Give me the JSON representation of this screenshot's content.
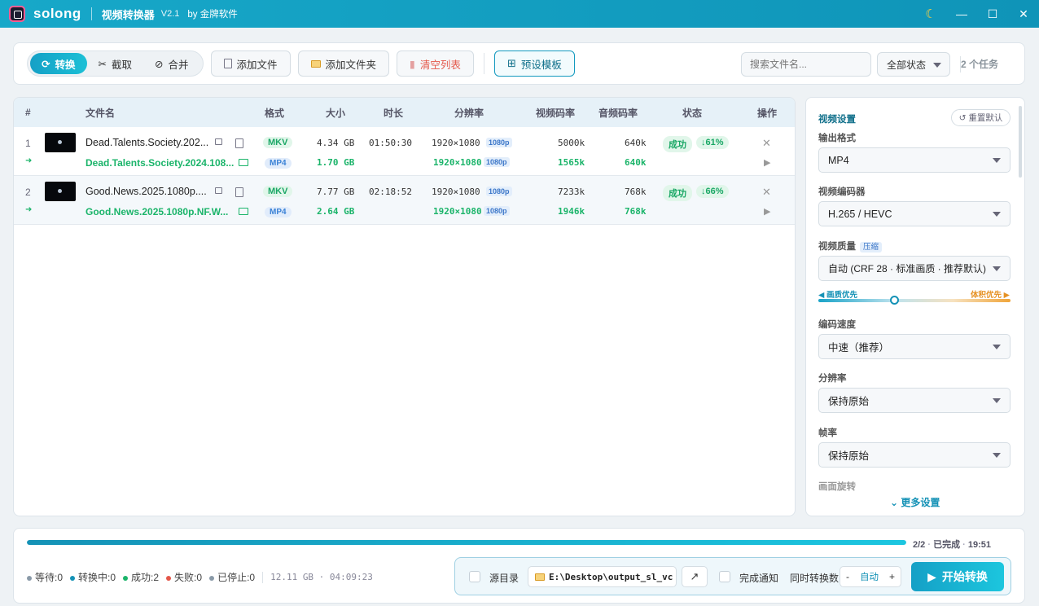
{
  "titlebar": {
    "brand": "solong",
    "app_name": "视频转换器",
    "version": "V2.1",
    "by": "by 金牌软件",
    "minimize": "—",
    "maximize": "☐",
    "close": "✕",
    "theme_icon": "☾"
  },
  "toolbar": {
    "modes": [
      {
        "label": "转换",
        "icon": "⟳"
      },
      {
        "label": "截取",
        "icon": "✂"
      },
      {
        "label": "合并",
        "icon": "⊘"
      }
    ],
    "add_file": "添加文件",
    "add_folder": "添加文件夹",
    "clear_list": "清空列表",
    "preset": "预设模板",
    "search_placeholder": "搜索文件名...",
    "status_filter": "全部状态",
    "task_count": "2 个任务"
  },
  "table": {
    "headers": {
      "index": "#",
      "name": "文件名",
      "format": "格式",
      "size": "大小",
      "duration": "时长",
      "resolution": "分辨率",
      "vbitrate": "视频码率",
      "abitrate": "音频码率",
      "status": "状态",
      "action": "操作"
    },
    "rows": [
      {
        "index": "1",
        "name": "Dead.Talents.Society.202...",
        "out_name": "Dead.Talents.Society.2024.108...",
        "format": "MKV",
        "out_format": "MP4",
        "size": "4.34 GB",
        "out_size": "1.70 GB",
        "duration": "01:50:30",
        "resolution": "1920×1080",
        "res_tag": "1080p",
        "out_resolution": "1920×1080",
        "out_res_tag": "1080p",
        "vbitrate": "5000k",
        "out_vbitrate": "1565k",
        "abitrate": "640k",
        "out_abitrate": "640k",
        "status": "成功",
        "reduction": "↓61%",
        "arrow": "➜"
      },
      {
        "index": "2",
        "name": "Good.News.2025.1080p....",
        "out_name": "Good.News.2025.1080p.NF.W...",
        "format": "MKV",
        "out_format": "MP4",
        "size": "7.77 GB",
        "out_size": "2.64 GB",
        "duration": "02:18:52",
        "resolution": "1920×1080",
        "res_tag": "1080p",
        "out_resolution": "1920×1080",
        "out_res_tag": "1080p",
        "vbitrate": "7233k",
        "out_vbitrate": "1946k",
        "abitrate": "768k",
        "out_abitrate": "768k",
        "status": "成功",
        "reduction": "↓66%",
        "arrow": "➜"
      }
    ]
  },
  "settings": {
    "title": "视频设置",
    "reset": "重置默认",
    "output_format_label": "输出格式",
    "output_format": "MP4",
    "codec_label": "视频编码器",
    "codec": "H.265 / HEVC",
    "quality_label": "视频质量",
    "quality_tag": "压缩",
    "quality": "自动 (CRF 28 · 标准画质 · 推荐默认)",
    "slider_left": "◀ 画质优先",
    "slider_right": "体积优先 ▶",
    "slider_level": 0.4,
    "speed_label": "编码速度",
    "speed": "中速（推荐）",
    "resolution_label": "分辨率",
    "resolution": "保持原始",
    "fps_label": "帧率",
    "fps": "保持原始",
    "rotate_label": "画面旋转",
    "more": "⌄ 更多设置"
  },
  "bottom": {
    "progress": 1.0,
    "progress_count": "2/2",
    "progress_state": "已完成",
    "time": "19:51",
    "counts": [
      {
        "label": "等待:0",
        "color": "#8a9aa8"
      },
      {
        "label": "转换中:0",
        "color": "#1592b6"
      },
      {
        "label": "成功:2",
        "color": "#1bb46a"
      },
      {
        "label": "失败:0",
        "color": "#e4574a"
      },
      {
        "label": "已停止:0",
        "color": "#8a9aa8"
      }
    ],
    "totals": "12.11 GB · 04:09:23",
    "source_dir": "源目录",
    "output_path": "E:\\Desktop\\output_sl_vc",
    "notify": "完成通知",
    "concurrency_label": "同时转换数",
    "concurrency": "自动",
    "minus": "-",
    "plus": "+",
    "start": "开始转换"
  }
}
